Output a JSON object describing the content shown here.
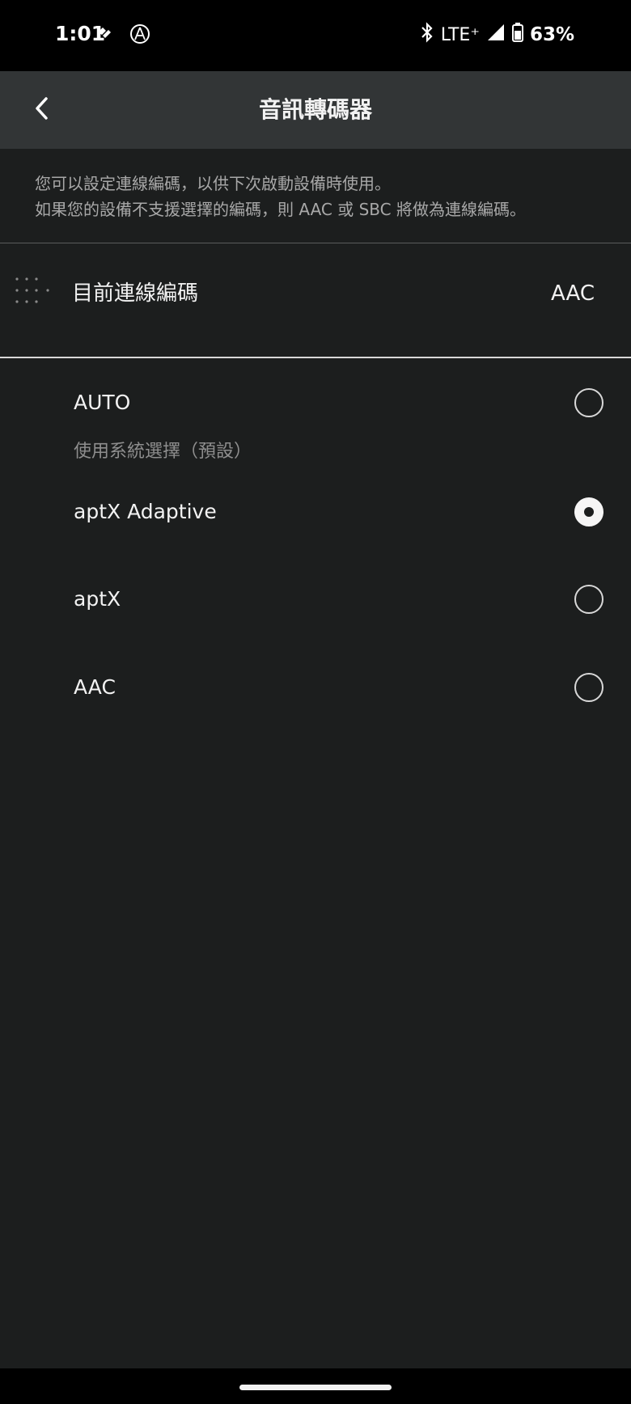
{
  "status_bar": {
    "time": "1:01",
    "network": "LTE⁺",
    "battery": "63%",
    "icons": [
      "shield-check-icon",
      "audio-technica-logo-icon",
      "bluetooth-icon",
      "signal-icon",
      "battery-icon"
    ]
  },
  "app_bar": {
    "title": "音訊轉碼器",
    "back_icon": "chevron-left-icon"
  },
  "description": {
    "line1": "您可以設定連線編碼，以供下次啟動設備時使用。",
    "line2": "如果您的設備不支援選擇的編碼，則 AAC 或 SBC 將做為連線編碼。"
  },
  "current_codec": {
    "label": "目前連線編碼",
    "value": "AAC",
    "icon": "drag-handle-icon"
  },
  "options": [
    {
      "label": "AUTO",
      "sublabel": "使用系統選擇（預設）",
      "selected": false
    },
    {
      "label": "aptX Adaptive",
      "selected": true
    },
    {
      "label": "aptX",
      "selected": false
    },
    {
      "label": "AAC",
      "selected": false
    }
  ],
  "colors": {
    "background": "#1c1e1e",
    "app_bar": "#323536",
    "status_bar": "#000000",
    "text_primary": "#f2f2f2",
    "text_secondary": "#a8a8a8"
  }
}
